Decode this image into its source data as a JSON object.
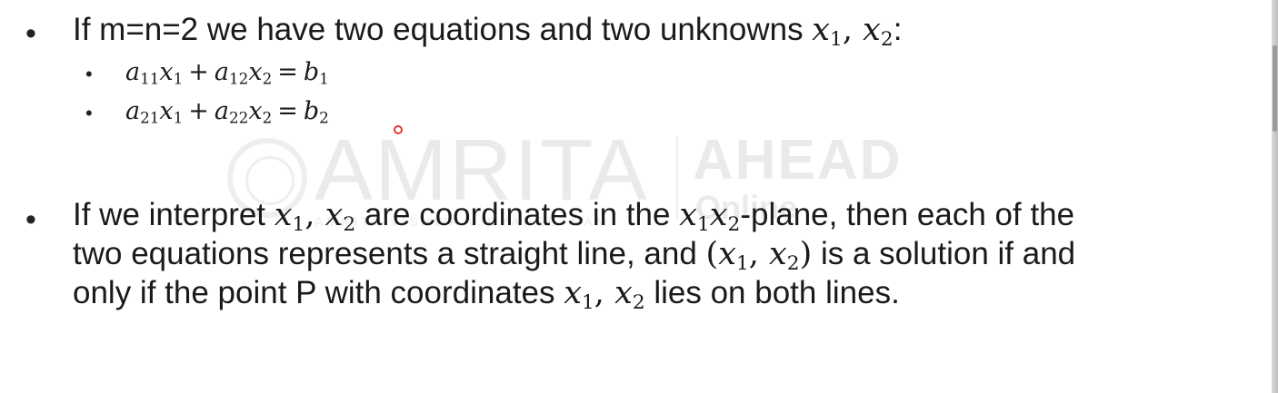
{
  "watermark": {
    "brand": "AMRITA",
    "brand_secondary": "AHEAD",
    "secondary_sub": "Online",
    "tagline": "AMRITA VISHWA VIDYAPEETHAM"
  },
  "bullets": [
    {
      "prefix": "If m=n=2 we have two equations and two unknowns ",
      "vars": [
        "x",
        "1",
        "x",
        "2"
      ],
      "suffix": ":",
      "equations": [
        {
          "terms": [
            "a",
            "11",
            "x",
            "1",
            "a",
            "12",
            "x",
            "2",
            "b",
            "1"
          ],
          "plus": "+",
          "equals": "="
        },
        {
          "terms": [
            "a",
            "21",
            "x",
            "1",
            "a",
            "22",
            "x",
            "2",
            "b",
            "2"
          ],
          "plus": "+",
          "equals": "="
        }
      ]
    },
    {
      "line1_a": "If we interpret ",
      "line1_b": " are coordinates in the ",
      "line1_c": "-plane, then each of the",
      "line2_a": "two equations represents a straight line, and ",
      "line2_b": " is a solution if and",
      "line3_a": "only if the point P with coordinates ",
      "line3_b": " lies on both lines."
    }
  ],
  "colors": {
    "text": "#1a1a1a",
    "cursor": "#e23a2f",
    "background": "#ffffff"
  }
}
